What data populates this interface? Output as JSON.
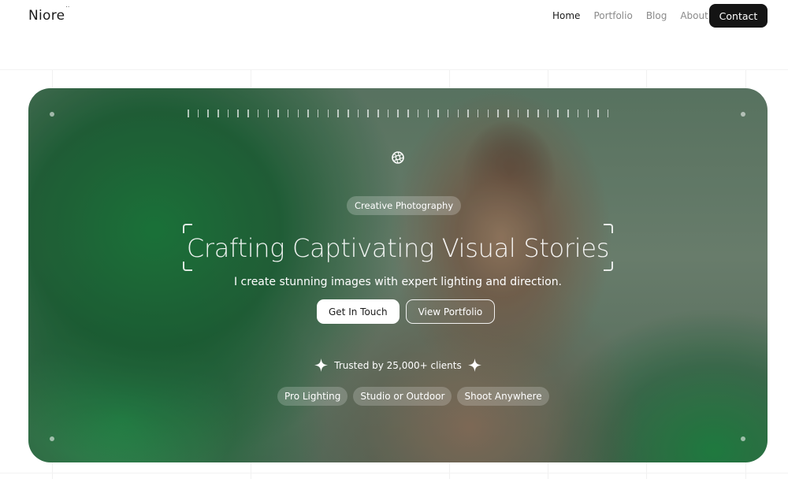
{
  "nav": {
    "brand": "Niore",
    "brand_mark": "··",
    "links": [
      {
        "label": "Home",
        "active": true
      },
      {
        "label": "Portfolio",
        "active": false
      },
      {
        "label": "Blog",
        "active": false
      },
      {
        "label": "About",
        "active": false
      }
    ],
    "contact_label": "Contact"
  },
  "hero": {
    "badge": "Creative Photography",
    "headline": "Crafting Captivating Visual Stories",
    "subtitle": "I create stunning images with expert lighting and direction.",
    "primary_button": "Get In Touch",
    "secondary_button": "View Portfolio",
    "trust_text": "Trusted by 25,000+ clients",
    "chips": [
      "Pro Lighting",
      "Studio or Outdoor",
      "Shoot Anywhere"
    ],
    "icons": {
      "aperture": "aperture-icon",
      "sparkle": "sparkle-icon"
    }
  },
  "colors": {
    "accent_dark": "#141414",
    "hero_green": "#1c7a3c",
    "text_muted": "#8a8a8a"
  }
}
